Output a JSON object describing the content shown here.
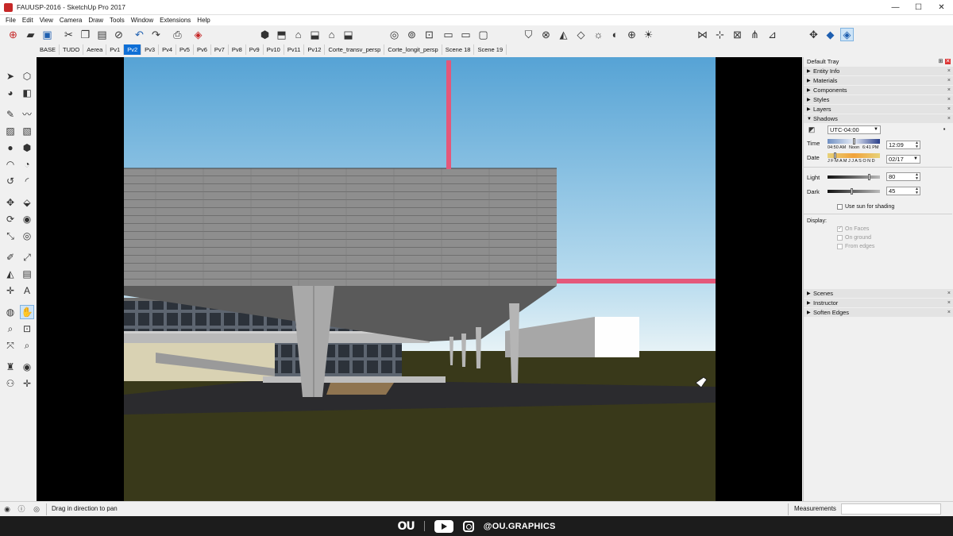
{
  "window": {
    "title": "FAUUSP-2016 - SketchUp Pro 2017",
    "controls": [
      "—",
      "☐",
      "✕"
    ]
  },
  "menu": [
    "File",
    "Edit",
    "View",
    "Camera",
    "Draw",
    "Tools",
    "Window",
    "Extensions",
    "Help"
  ],
  "scenes": {
    "tabs": [
      "BASE",
      "TUDO",
      "Aerea",
      "Pv1",
      "Pv2",
      "Pv3",
      "Pv4",
      "Pv5",
      "Pv6",
      "Pv7",
      "Pv8",
      "Pv9",
      "Pv10",
      "Pv11",
      "Pv12",
      "Corte_transv_persp",
      "Corte_longit_persp",
      "Scene 18",
      "Scene 19"
    ],
    "active": "Pv2"
  },
  "toolbar": {
    "icons": [
      "new-model-icon",
      "open-icon",
      "save-icon",
      "cut-icon",
      "copy-icon",
      "paste-icon",
      "erase-icon",
      "undo-icon",
      "redo-icon",
      "print-icon",
      "model-info-icon",
      "iso-view-icon",
      "top-view-icon",
      "front-view-icon",
      "right-view-icon",
      "back-view-icon",
      "left-view-icon",
      "xray-icon",
      "back-edges-icon",
      "wireframe-icon",
      "hidden-line-icon",
      "shaded-icon",
      "shaded-textures-icon",
      "monochrome-icon",
      "section-plane-icon",
      "display-sections-icon",
      "section-cuts-icon",
      "add-location-icon",
      "toggle-terrain-icon",
      "get-models-icon",
      "extension-warehouse-icon",
      "sandbox-from-contours-icon",
      "sandbox-smoove-icon",
      "sandbox-stamp-icon",
      "sandbox-drape-icon",
      "sandbox-flip-icon",
      "orbit-icon",
      "position-camera-icon",
      "walk-icon"
    ]
  },
  "lefttools": {
    "icons": [
      "select-icon",
      "make-component-icon",
      "paint-bucket-icon",
      "eraser-icon",
      "line-icon",
      "freehand-icon",
      "rectangle-icon",
      "rotated-rectangle-icon",
      "circle-icon",
      "polygon-icon",
      "arc-icon",
      "pie-icon",
      "two-point-arc-icon",
      "three-point-arc-icon",
      "move-icon",
      "push-pull-icon",
      "rotate-icon",
      "follow-me-icon",
      "scale-icon",
      "offset-icon",
      "tape-measure-icon",
      "dimension-icon",
      "protractor-icon",
      "text-icon",
      "axes-icon",
      "3d-text-icon",
      "orbit-tool-icon",
      "pan-tool-icon",
      "zoom-icon",
      "zoom-window-icon",
      "zoom-extents-icon",
      "previous-view-icon",
      "position-camera-tool-icon",
      "look-around-icon",
      "walk-tool-icon",
      "section-plane-tool-icon"
    ]
  },
  "tray": {
    "title": "Default Tray",
    "panels_top": [
      "Entity Info",
      "Materials",
      "Components",
      "Styles",
      "Layers"
    ],
    "shadows": {
      "title": "Shadows",
      "timezone": "UTC-04:00",
      "time_label": "Time",
      "time_value": "12:09",
      "time_marks": [
        "04:50 AM",
        "Noon",
        "6:41 PM"
      ],
      "date_label": "Date",
      "date_value": "02/17",
      "months": "J F M A M J J A S O N D",
      "light_label": "Light",
      "light_value": "80",
      "light_level": 0.8,
      "dark_label": "Dark",
      "dark_value": "45",
      "dark_level": 0.45,
      "time_level": 0.5,
      "date_level": 0.12,
      "use_sun": "Use sun for shading",
      "display_label": "Display:",
      "on_faces": "On Faces",
      "on_ground": "On ground",
      "from_edges": "From edges"
    },
    "panels_bottom": [
      "Scenes",
      "Instructor",
      "Soften Edges"
    ]
  },
  "status": {
    "message": "Drag in direction to pan",
    "measurements_label": "Measurements",
    "measurements_value": ""
  },
  "branding": {
    "logo": "OU",
    "handle": "@OU.GRAPHICS"
  },
  "colors": {
    "sky_top": "#5aa5d6",
    "sky_bottom": "#cfe6f1",
    "ground": "#3b3a1b",
    "concrete": "#8c8c8c",
    "section_line": "#e4587a",
    "active_tab": "#0f6fd6"
  }
}
